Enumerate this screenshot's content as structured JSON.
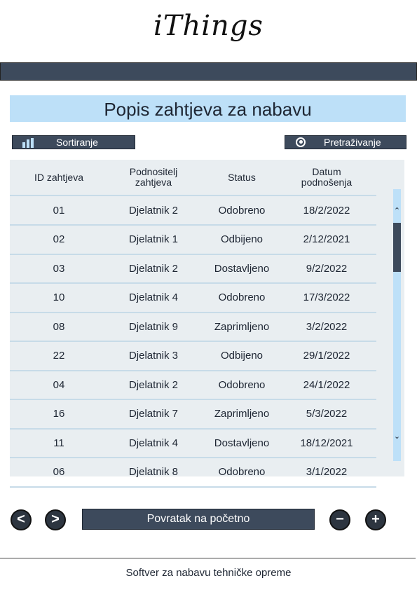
{
  "app": {
    "logo": "iThings"
  },
  "page": {
    "title": "Popis zahtjeva za nabavu"
  },
  "toolbar": {
    "sort_label": "Sortiranje",
    "search_label": "Pretraživanje"
  },
  "table": {
    "headers": {
      "id": "ID zahtjeva",
      "submitter_line1": "Podnositelj",
      "submitter_line2": "zahtjeva",
      "status": "Status",
      "date_line1": "Datum",
      "date_line2": "podnošenja"
    },
    "rows": [
      {
        "id": "01",
        "submitter": "Djelatnik 2",
        "status": "Odobreno",
        "date": "18/2/2022"
      },
      {
        "id": "02",
        "submitter": "Djelatnik 1",
        "status": "Odbijeno",
        "date": "2/12/2021"
      },
      {
        "id": "03",
        "submitter": "Djelatnik 2",
        "status": "Dostavljeno",
        "date": "9/2/2022"
      },
      {
        "id": "10",
        "submitter": "Djelatnik 4",
        "status": "Odobreno",
        "date": "17/3/2022"
      },
      {
        "id": "08",
        "submitter": "Djelatnik 9",
        "status": "Zaprimljeno",
        "date": "3/2/2022"
      },
      {
        "id": "22",
        "submitter": "Djelatnik 3",
        "status": "Odbijeno",
        "date": "29/1/2022"
      },
      {
        "id": "04",
        "submitter": "Djelatnik 2",
        "status": "Odobreno",
        "date": "24/1/2022"
      },
      {
        "id": "16",
        "submitter": "Djelatnik 7",
        "status": "Zaprimljeno",
        "date": "5/3/2022"
      },
      {
        "id": "11",
        "submitter": "Djelatnik 4",
        "status": "Dostavljeno",
        "date": "18/12/2021"
      },
      {
        "id": "06",
        "submitter": "Djelatnik 8",
        "status": "Odobreno",
        "date": "3/1/2022"
      }
    ]
  },
  "nav": {
    "prev_icon": "<",
    "next_icon": ">",
    "home_label": "Povratak na početno",
    "minus_icon": "−",
    "plus_icon": "+"
  },
  "footer": {
    "text": "Softver za nabavu tehničke opreme"
  },
  "colors": {
    "accent_light": "#bde0f8",
    "accent_dark": "#3d4a5c",
    "table_bg": "#e9eef1"
  },
  "icons": {
    "sort": "bar-chart-icon",
    "search": "globe-icon",
    "prev": "chevron-left-icon",
    "next": "chevron-right-icon",
    "minus": "minus-circle-icon",
    "plus": "plus-circle-icon",
    "scroll_up": "chevron-up-icon",
    "scroll_down": "chevron-down-icon"
  }
}
